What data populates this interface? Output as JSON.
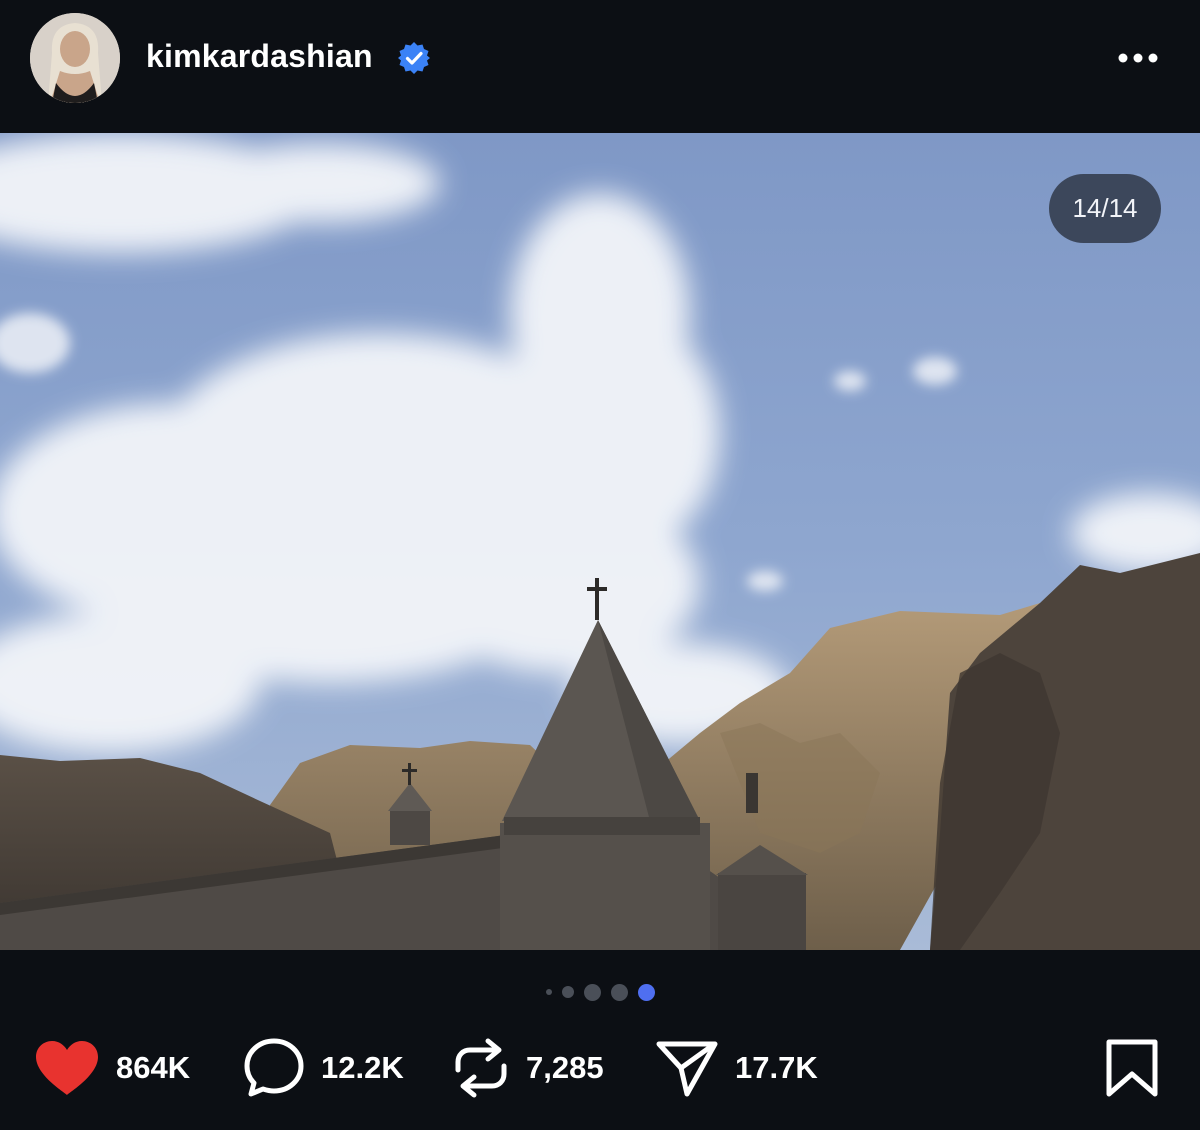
{
  "header": {
    "username": "kimkardashian",
    "verified_icon": "verified-badge-icon",
    "more_icon": "more-horizontal-icon"
  },
  "media": {
    "counter": "14/14",
    "description_icon": "photo",
    "carousel": {
      "visible_dots": 5,
      "active_index": 4
    }
  },
  "actions": {
    "like": {
      "icon": "heart-icon",
      "count": "864K",
      "color": "#e8332f"
    },
    "comment": {
      "icon": "comment-icon",
      "count": "12.2K"
    },
    "repost": {
      "icon": "repost-icon",
      "count": "7,285"
    },
    "share": {
      "icon": "send-icon",
      "count": "17.7K"
    },
    "bookmark": {
      "icon": "bookmark-icon"
    }
  },
  "colors": {
    "background": "#0c0f14",
    "accent": "#4f6ff0",
    "like": "#e8332f",
    "verified": "#3b82f6"
  }
}
